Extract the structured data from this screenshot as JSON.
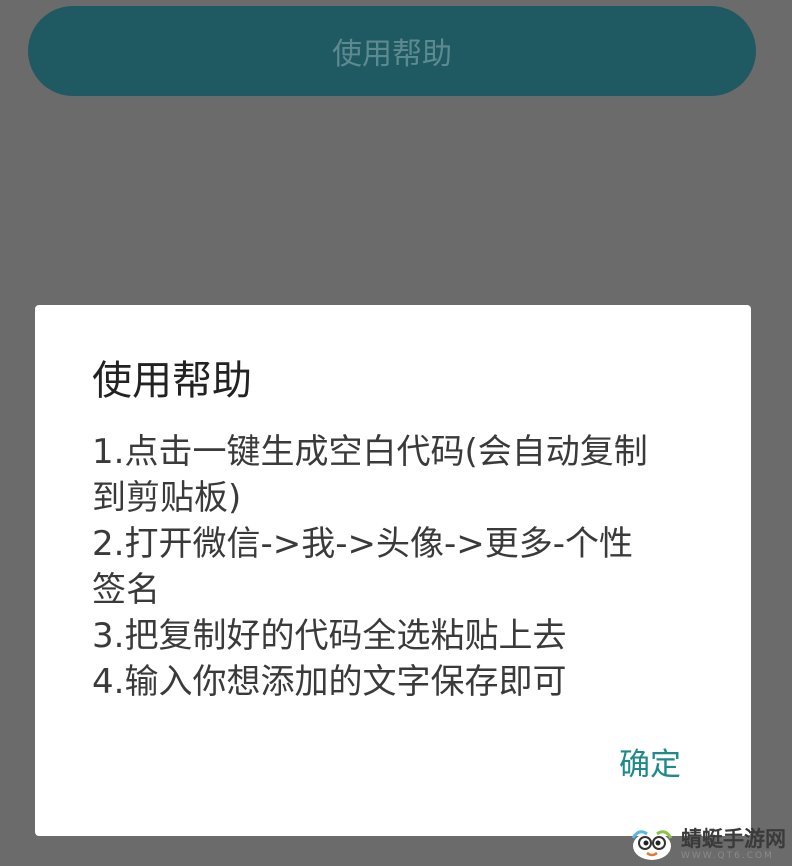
{
  "background_button": {
    "label": "使用帮助"
  },
  "dialog": {
    "title": "使用帮助",
    "lines": [
      "1.点击一键生成空白代码(会自动复制",
      "到剪贴板)",
      "2.打开微信->我->头像->更多-个性",
      "签名",
      "3.把复制好的代码全选粘贴上去",
      "4.输入你想添加的文字保存即可"
    ],
    "confirm_label": "确定"
  },
  "watermark": {
    "name": "蜻蜓手游网",
    "url": "WWW.QT6.COM",
    "logo_icon": "dragonfly-logo-icon"
  },
  "colors": {
    "overlay": "#6b6b6b",
    "button_bg": "#1f5961",
    "button_text": "#5d8a90",
    "dialog_bg": "#ffffff",
    "accent": "#1f8a8a"
  }
}
